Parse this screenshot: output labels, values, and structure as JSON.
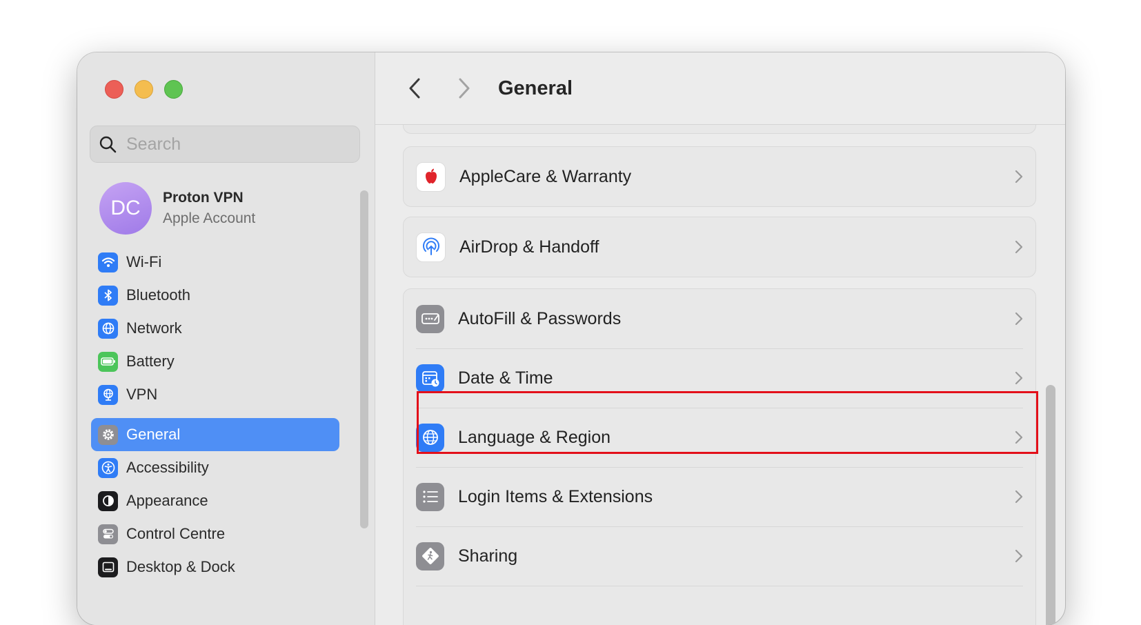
{
  "window": {
    "title": "General",
    "controls": {
      "close": "close",
      "minimize": "minimize",
      "zoom": "zoom"
    }
  },
  "sidebar": {
    "search": {
      "placeholder": "Search",
      "value": ""
    },
    "account": {
      "initials": "DC",
      "name": "Proton VPN",
      "subtitle": "Apple Account"
    },
    "group1": [
      {
        "label": "Wi-Fi",
        "icon": "wifi-icon",
        "color": "#2f7cf6"
      },
      {
        "label": "Bluetooth",
        "icon": "bluetooth-icon",
        "color": "#2f7cf6"
      },
      {
        "label": "Network",
        "icon": "globe-icon",
        "color": "#2f7cf6"
      },
      {
        "label": "Battery",
        "icon": "battery-icon",
        "color": "#4cc55a"
      },
      {
        "label": "VPN",
        "icon": "vpn-globe-icon",
        "color": "#2f7cf6"
      }
    ],
    "group2": [
      {
        "label": "General",
        "icon": "gear-icon",
        "color": "#8e8e93",
        "selected": true
      },
      {
        "label": "Accessibility",
        "icon": "accessibility-icon",
        "color": "#2f7cf6"
      },
      {
        "label": "Appearance",
        "icon": "appearance-icon",
        "color": "#1c1c1e"
      },
      {
        "label": "Control Centre",
        "icon": "control-centre-icon",
        "color": "#8e8e93"
      },
      {
        "label": "Desktop & Dock",
        "icon": "dock-icon",
        "color": "#1c1c1e"
      }
    ]
  },
  "main": {
    "rows": [
      {
        "label": "AppleCare & Warranty",
        "icon": "apple-logo-icon"
      },
      {
        "label": "AirDrop & Handoff",
        "icon": "airdrop-icon"
      },
      {
        "label": "AutoFill & Passwords",
        "icon": "autofill-icon"
      },
      {
        "label": "Date & Time",
        "icon": "calendar-clock-icon"
      },
      {
        "label": "Language & Region",
        "icon": "language-globe-icon"
      },
      {
        "label": "Login Items & Extensions",
        "icon": "list-icon",
        "highlighted": true
      },
      {
        "label": "Sharing",
        "icon": "sharing-icon"
      }
    ]
  },
  "colors": {
    "accent": "#4f8ff5",
    "highlight_border": "#e3101a"
  }
}
